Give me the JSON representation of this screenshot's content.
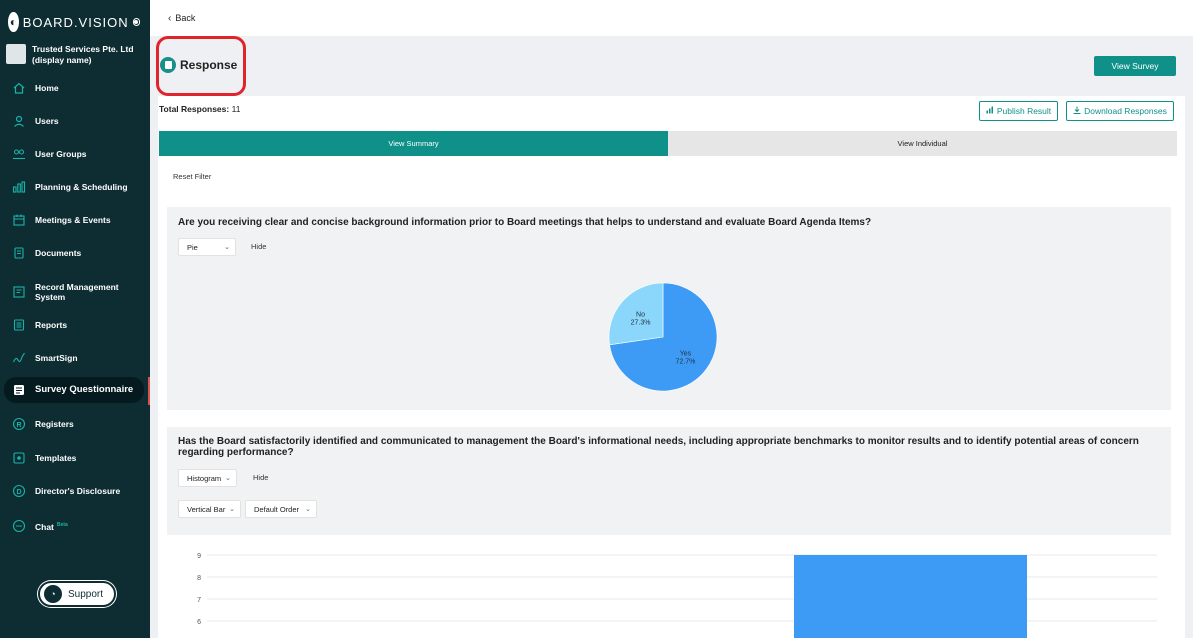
{
  "brand": {
    "name": "BOARD.VISION"
  },
  "org": {
    "name": "Trusted Services Pte. Ltd (display name)"
  },
  "nav": [
    {
      "label": "Home",
      "icon": "home-icon"
    },
    {
      "label": "Users",
      "icon": "user-icon"
    },
    {
      "label": "User Groups",
      "icon": "users-icon"
    },
    {
      "label": "Planning & Scheduling",
      "icon": "planning-icon"
    },
    {
      "label": "Meetings & Events",
      "icon": "calendar-icon"
    },
    {
      "label": "Documents",
      "icon": "documents-icon"
    },
    {
      "label": "Record Management System",
      "icon": "record-icon"
    },
    {
      "label": "Reports",
      "icon": "reports-icon"
    },
    {
      "label": "SmartSign",
      "icon": "signature-icon"
    },
    {
      "label": "Survey Questionnaire",
      "icon": "survey-icon",
      "active": true
    },
    {
      "label": "Registers",
      "icon": "registered-icon"
    },
    {
      "label": "Templates",
      "icon": "templates-icon"
    },
    {
      "label": "Director's Disclosure",
      "icon": "disclosure-icon"
    },
    {
      "label": "Chat",
      "icon": "chat-icon",
      "badge": "Beta"
    }
  ],
  "support": {
    "label": "Support"
  },
  "topbar": {
    "back": "Back"
  },
  "page": {
    "title": "Response",
    "view_survey": "View Survey",
    "total_label": "Total Responses:",
    "total_value": "11",
    "publish": "Publish Result",
    "download": "Download Responses",
    "tabs": [
      "View Summary",
      "View Individual"
    ],
    "reset_filter": "Reset Filter"
  },
  "q1": {
    "text": "Are you receiving clear and concise background information prior to Board meetings that helps to understand and evaluate Board Agenda Items?",
    "chart_type": "Pie",
    "hide": "Hide"
  },
  "q2": {
    "text": "Has the Board satisfactorily identified and communicated to management the Board's informational needs, including appropriate benchmarks to monitor results and to identify potential areas of concern regarding performance?",
    "chart_type": "Histogram",
    "hide": "Hide",
    "orientation": "Vertical Bar",
    "order": "Default Order"
  },
  "colors": {
    "teal": "#0f9189",
    "sidebar": "#0e2d33",
    "pie_yes": "#3d9bf5",
    "pie_no": "#8ad7fb",
    "bar": "#3d9bf5"
  },
  "chart_data": [
    {
      "type": "pie",
      "slices": [
        {
          "label": "Yes",
          "value": 72.7,
          "display": "72.7%"
        },
        {
          "label": "No",
          "value": 27.3,
          "display": "27.3%"
        }
      ]
    },
    {
      "type": "bar",
      "y_ticks": [
        6,
        7,
        8,
        9
      ],
      "bars": [
        {
          "value": 9
        }
      ],
      "grid": true
    }
  ]
}
